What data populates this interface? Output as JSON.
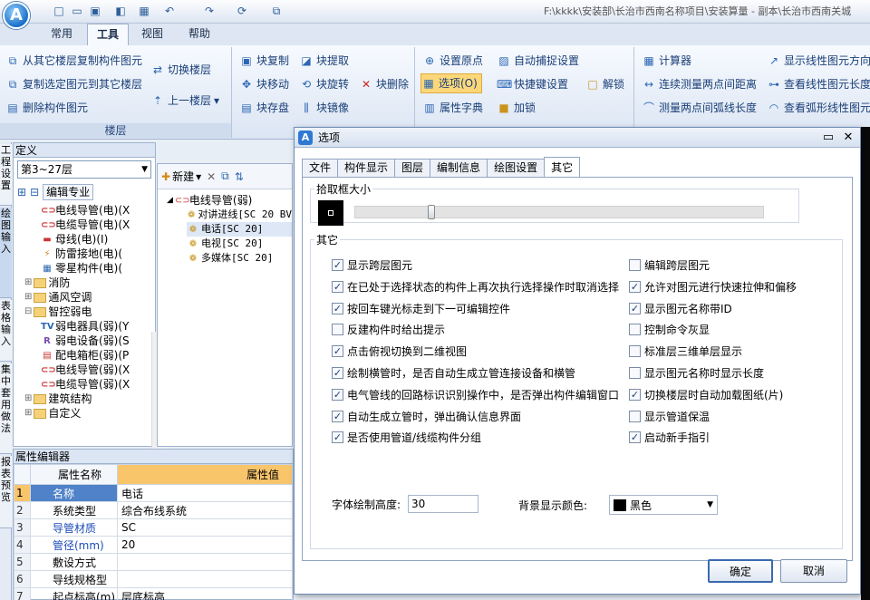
{
  "app": {
    "title": "F:\\kkkk\\安装部\\长治市西南名称项目\\安装算量 - 副本\\长治市西南关城"
  },
  "ribbon_tabs": [
    "常用",
    "工具",
    "视图",
    "帮助"
  ],
  "ribbon": {
    "floor_group": {
      "caption": "楼层",
      "copy_from_floor": "从其它楼层复制构件图元",
      "copy_to_floor": "复制选定图元到其它楼层",
      "delete_elements": "删除构件图元",
      "switch_floor": "切换楼层",
      "prev_floor": "上一楼层"
    },
    "block_group": {
      "copy": "块复制",
      "move": "块移动",
      "save": "块存盘",
      "extract": "块提取",
      "rotate": "块旋转",
      "mirror": "块镜像",
      "delete": "块删除"
    },
    "options_group": {
      "origin": "设置原点",
      "options": "选项(O)",
      "attr_dict": "属性字典",
      "autosnap": "自动捕捉设置",
      "shortcut": "快捷键设置",
      "lock": "加锁",
      "unlock": "解锁"
    },
    "measure_group": {
      "calculator": "计算器",
      "continuous": "连续测量两点间距离",
      "two_points": "测量两点间弧线长度",
      "show_dir": "显示线性图元方向",
      "view_line_len": "查看线性图元长度",
      "view_arc_len": "查看弧形线性图元"
    }
  },
  "vertical_tabs": [
    "工程设置",
    "绘图输入",
    "表格输入",
    "集中套用做法",
    "报表预览"
  ],
  "definition_panel": {
    "title": "定义",
    "floor_selector": "第3~27层",
    "edit_specialty": "编辑专业",
    "tree": [
      {
        "label": "电线导管(电)(X",
        "indent": 2,
        "icon": "conduit"
      },
      {
        "label": "电缆导管(电)(X",
        "indent": 2,
        "icon": "conduit"
      },
      {
        "label": "母线(电)(I)",
        "indent": 2,
        "icon": "bus"
      },
      {
        "label": "防雷接地(电)(",
        "indent": 2,
        "icon": "ground"
      },
      {
        "label": "零星构件(电)(",
        "indent": 2,
        "icon": "misc"
      },
      {
        "label": "消防",
        "indent": 1,
        "icon": "folder",
        "toggle": "+"
      },
      {
        "label": "通风空调",
        "indent": 1,
        "icon": "folder",
        "toggle": "+"
      },
      {
        "label": "智控弱电",
        "indent": 1,
        "icon": "folder",
        "toggle": "-"
      },
      {
        "label": "弱电器具(弱)(Y",
        "indent": 2,
        "icon": "tv"
      },
      {
        "label": "弱电设备(弱)(S",
        "indent": 2,
        "icon": "device"
      },
      {
        "label": "配电箱柜(弱)(P",
        "indent": 2,
        "icon": "cabinet"
      },
      {
        "label": "电线导管(弱)(X",
        "indent": 2,
        "icon": "conduit"
      },
      {
        "label": "电缆导管(弱)(X",
        "indent": 2,
        "icon": "conduit"
      },
      {
        "label": "建筑结构",
        "indent": 1,
        "icon": "folder",
        "toggle": "+"
      },
      {
        "label": "自定义",
        "indent": 1,
        "icon": "folder",
        "toggle": "+"
      }
    ]
  },
  "component_panel": {
    "new_button": "新建",
    "root": "电线导管(弱)",
    "items": [
      "对讲进线[SC 20 BV",
      "电话[SC 20]",
      "电视[SC 20]",
      "多媒体[SC 20]"
    ]
  },
  "property_editor": {
    "title": "属性编辑器",
    "col_name": "属性名称",
    "col_value": "属性值",
    "rows": [
      {
        "num": "1",
        "name": "名称",
        "value": "电话",
        "blue": true
      },
      {
        "num": "2",
        "name": "系统类型",
        "value": "综合布线系统",
        "blue": false
      },
      {
        "num": "3",
        "name": "导管材质",
        "value": "SC",
        "blue": true
      },
      {
        "num": "4",
        "name": "管径(mm)",
        "value": "20",
        "blue": true
      },
      {
        "num": "5",
        "name": "敷设方式",
        "value": "",
        "blue": false
      },
      {
        "num": "6",
        "name": "导线规格型",
        "value": "",
        "blue": false
      },
      {
        "num": "7",
        "name": "起点标高(m)",
        "value": "层底标高",
        "blue": false
      }
    ]
  },
  "dialog": {
    "title": "选项",
    "tabs": [
      "文件",
      "构件显示",
      "图层",
      "编制信息",
      "绘图设置",
      "其它"
    ],
    "pick_box_label": "拾取框大小",
    "pick_box_value": 0.18,
    "other_label": "其它",
    "left_options": [
      {
        "label": "显示跨层图元",
        "checked": true
      },
      {
        "label": "在已处于选择状态的构件上再次执行选择操作时取消选择",
        "checked": true
      },
      {
        "label": "按回车键光标走到下一可编辑控件",
        "checked": true
      },
      {
        "label": "反建构件时给出提示",
        "checked": false
      },
      {
        "label": "点击俯视切换到二维视图",
        "checked": true
      },
      {
        "label": "绘制横管时，是否自动生成立管连接设备和横管",
        "checked": true
      },
      {
        "label": "电气管线的回路标识识别操作中，是否弹出构件编辑窗口",
        "checked": true
      },
      {
        "label": "自动生成立管时，弹出确认信息界面",
        "checked": true
      },
      {
        "label": "是否使用管道/线缆构件分组",
        "checked": true
      }
    ],
    "right_options": [
      {
        "label": "编辑跨层图元",
        "checked": false
      },
      {
        "label": "允许对图元进行快速拉伸和偏移",
        "checked": true
      },
      {
        "label": "显示图元名称带ID",
        "checked": true
      },
      {
        "label": "控制命令灰显",
        "checked": false
      },
      {
        "label": "标准层三维单层显示",
        "checked": false
      },
      {
        "label": "显示图元名称时显示长度",
        "checked": false
      },
      {
        "label": "切换楼层时自动加载图纸(片)",
        "checked": true
      },
      {
        "label": "显示管道保温",
        "checked": false
      },
      {
        "label": "启动新手指引",
        "checked": true
      }
    ],
    "font_height_label": "字体绘制高度:",
    "font_height_value": "30",
    "bg_color_label": "背景显示颜色:",
    "bg_color_value": "黑色",
    "ok_button": "确定",
    "cancel_button": "取消"
  },
  "colors": {
    "selected": "#4f82c8",
    "highlight": "#fbd77a",
    "dialog_border": "#6f8fb8"
  }
}
